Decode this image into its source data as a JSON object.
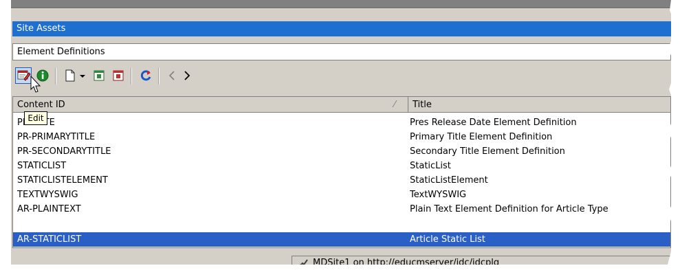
{
  "panel": {
    "title": "Site Assets",
    "definitions_label": "Element Definitions"
  },
  "toolbar": {
    "edit_tooltip": "Edit",
    "buttons": [
      "edit",
      "info",
      "new-document",
      "dropdown",
      "export",
      "delete",
      "refresh",
      "back",
      "forward"
    ]
  },
  "grid": {
    "columns": [
      "Content ID",
      "Title"
    ],
    "rows": [
      {
        "content_id": "PR-DATE",
        "title": "Pres Release Date Element Definition",
        "selected": false
      },
      {
        "content_id": "PR-PRIMARYTITLE",
        "title": "Primary Title Element Definition",
        "selected": false
      },
      {
        "content_id": "PR-SECONDARYTITLE",
        "title": "Secondary Title Element Definition",
        "selected": false
      },
      {
        "content_id": "STATICLIST",
        "title": "StaticList",
        "selected": false
      },
      {
        "content_id": "STATICLISTELEMENT",
        "title": "StaticListElement",
        "selected": false
      },
      {
        "content_id": "TEXTWYSWIG",
        "title": "TextWYSWIG",
        "selected": false
      },
      {
        "content_id": "AR-PLAINTEXT",
        "title": "Plain Text Element Definition for Article Type",
        "selected": false
      },
      {
        "content_id": "AR-STATICLIST",
        "title": "Article Static List",
        "selected": true
      }
    ]
  },
  "status": {
    "text": "MDSite1 on http://educmserver/idc/idcplg"
  },
  "colors": {
    "title_bar": "#1f6fd0",
    "selection": "#2a5fc6",
    "panel_bg": "#d4d0c8"
  }
}
